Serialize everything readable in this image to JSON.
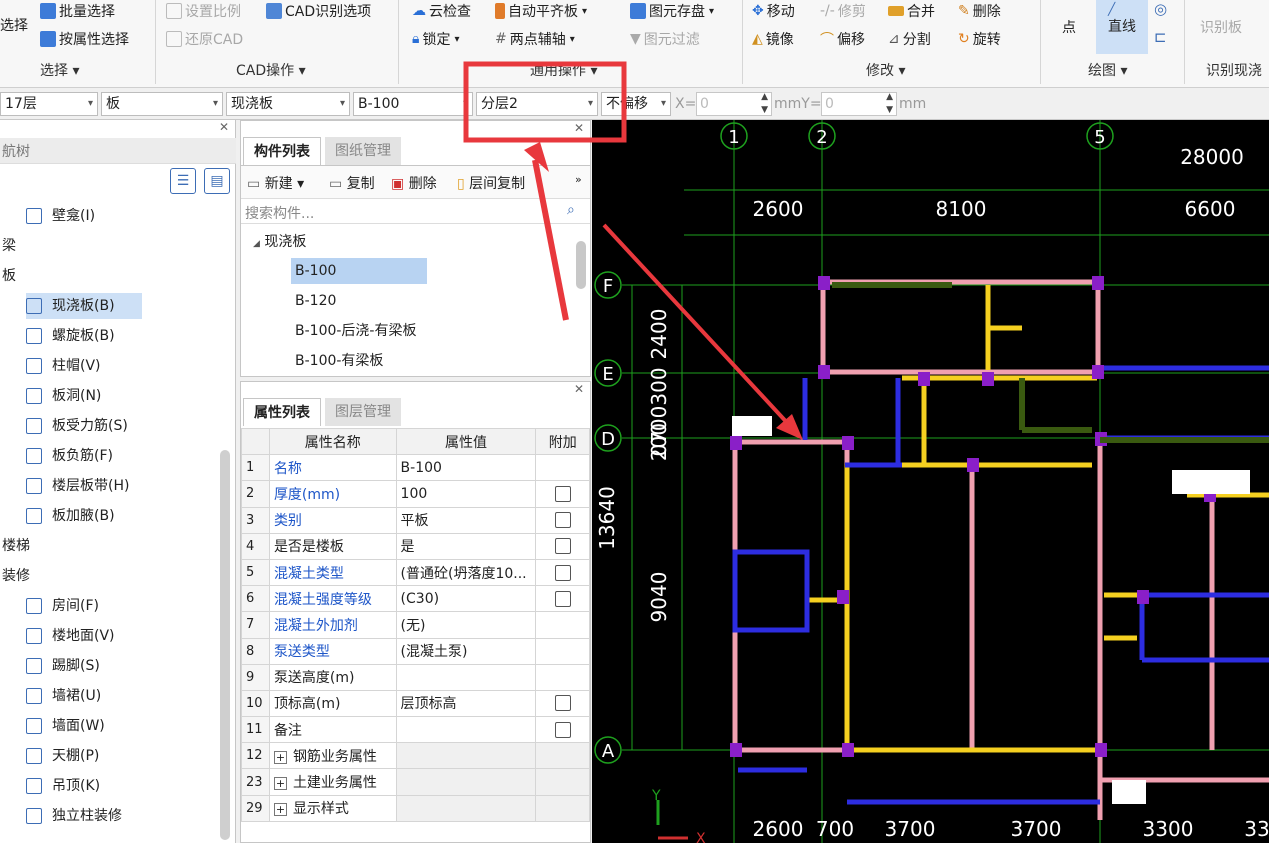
{
  "ribbon": {
    "select_group": {
      "partial_btn": "选择",
      "batch_select": "批量选择",
      "prop_select": "按属性选择",
      "label": "选择"
    },
    "cad_group": {
      "set_scale": "设置比例",
      "cad_recognize": "CAD识别选项",
      "restore_cad": "还原CAD",
      "label": "CAD操作"
    },
    "common_group": {
      "cloud_check": "云检查",
      "auto_align": "自动平齐板",
      "lock": "锁定",
      "two_point_axis": "两点辅轴",
      "save_element": "图元存盘",
      "element_filter": "图元过滤",
      "label": "通用操作"
    },
    "modify_group": {
      "move": "移动",
      "trim": "修剪",
      "merge": "合并",
      "delete": "删除",
      "mirror": "镜像",
      "offset": "偏移",
      "split": "分割",
      "rotate": "旋转",
      "label": "修改"
    },
    "draw_group": {
      "point": "点",
      "line": "直线",
      "label": "绘图"
    },
    "recognize_group": {
      "recognize_board": "识别板",
      "label": "识别现浇"
    }
  },
  "toolbar": {
    "floor": "17层",
    "category": "板",
    "type": "现浇板",
    "component": "B-100",
    "layer": "分层2",
    "offset_mode": "不偏移",
    "x_label": "X=",
    "x_value": "0",
    "y_label": "mmY=",
    "y_value": "0",
    "unit": "mm"
  },
  "nav": {
    "title": "航树",
    "items": [
      {
        "label": "壁龛(I)",
        "level": 2
      },
      {
        "label": "梁",
        "level": 1
      },
      {
        "label": "板",
        "level": 1
      },
      {
        "label": "现浇板(B)",
        "level": 2,
        "selected": true
      },
      {
        "label": "螺旋板(B)",
        "level": 2
      },
      {
        "label": "柱帽(V)",
        "level": 2
      },
      {
        "label": "板洞(N)",
        "level": 2
      },
      {
        "label": "板受力筋(S)",
        "level": 2
      },
      {
        "label": "板负筋(F)",
        "level": 2
      },
      {
        "label": "楼层板带(H)",
        "level": 2
      },
      {
        "label": "板加腋(B)",
        "level": 2
      },
      {
        "label": "楼梯",
        "level": 1
      },
      {
        "label": "装修",
        "level": 1
      },
      {
        "label": "房间(F)",
        "level": 2
      },
      {
        "label": "楼地面(V)",
        "level": 2
      },
      {
        "label": "踢脚(S)",
        "level": 2
      },
      {
        "label": "墙裙(U)",
        "level": 2
      },
      {
        "label": "墙面(W)",
        "level": 2
      },
      {
        "label": "天棚(P)",
        "level": 2
      },
      {
        "label": "吊顶(K)",
        "level": 2
      },
      {
        "label": "独立柱装修",
        "level": 2
      }
    ]
  },
  "components": {
    "tab_active": "构件列表",
    "tab_inactive": "图纸管理",
    "new": "新建",
    "copy": "复制",
    "delete": "删除",
    "copy_floor": "层间复制",
    "search_placeholder": "搜索构件...",
    "root": "现浇板",
    "items": [
      "B-100",
      "B-120",
      "B-100-后浇-有梁板",
      "B-100-有梁板"
    ]
  },
  "properties": {
    "tab_active": "属性列表",
    "tab_inactive": "图层管理",
    "col_name": "属性名称",
    "col_value": "属性值",
    "col_extra": "附加",
    "rows": [
      {
        "no": "1",
        "name": "名称",
        "value": "B-100",
        "blue": true,
        "check": false
      },
      {
        "no": "2",
        "name": "厚度(mm)",
        "value": "100",
        "blue": true,
        "check": true
      },
      {
        "no": "3",
        "name": "类别",
        "value": "平板",
        "blue": true,
        "check": true
      },
      {
        "no": "4",
        "name": "是否是楼板",
        "value": "是",
        "blue": false,
        "check": true
      },
      {
        "no": "5",
        "name": "混凝土类型",
        "value": "(普通砼(坍落度10...",
        "blue": true,
        "check": true
      },
      {
        "no": "6",
        "name": "混凝土强度等级",
        "value": "(C30)",
        "blue": true,
        "check": true
      },
      {
        "no": "7",
        "name": "混凝土外加剂",
        "value": "(无)",
        "blue": true,
        "check": false
      },
      {
        "no": "8",
        "name": "泵送类型",
        "value": "(混凝土泵)",
        "blue": true,
        "check": false
      },
      {
        "no": "9",
        "name": "泵送高度(m)",
        "value": "",
        "blue": false,
        "check": false
      },
      {
        "no": "10",
        "name": "顶标高(m)",
        "value": "层顶标高",
        "blue": false,
        "check": true
      },
      {
        "no": "11",
        "name": "备注",
        "value": "",
        "blue": false,
        "check": true
      },
      {
        "no": "12",
        "name": "钢筋业务属性",
        "value": "",
        "blue": false,
        "check": false,
        "group": true
      },
      {
        "no": "23",
        "name": "土建业务属性",
        "value": "",
        "blue": false,
        "check": false,
        "group": true
      },
      {
        "no": "29",
        "name": "显示样式",
        "value": "",
        "blue": false,
        "check": false,
        "group": true
      }
    ]
  },
  "cad": {
    "axes_top": [
      "1",
      "2",
      "5"
    ],
    "axes_left": [
      "F",
      "E",
      "D",
      "A"
    ],
    "dims_top_total": "28000",
    "dims_top": [
      "2600",
      "8100",
      "6600"
    ],
    "dims_left": [
      "2400",
      "1300",
      "700",
      "200"
    ],
    "dims_left_combined": "0700300",
    "dim_left_total": "13640",
    "dim_left_9040": "9040",
    "dims_bottom": [
      "2600",
      "700",
      "3700",
      "3700",
      "3300",
      "33"
    ],
    "ucs_y": "Y",
    "ucs_x": "X"
  },
  "colors": {
    "annotation": "#e8383d",
    "selection": "#cde0f6",
    "wall_pink": "#f0a0b0",
    "beam_yellow": "#f5d020",
    "purple": "#8a1fc8",
    "blue": "#2d2de0",
    "grid": "#1ea01e"
  }
}
